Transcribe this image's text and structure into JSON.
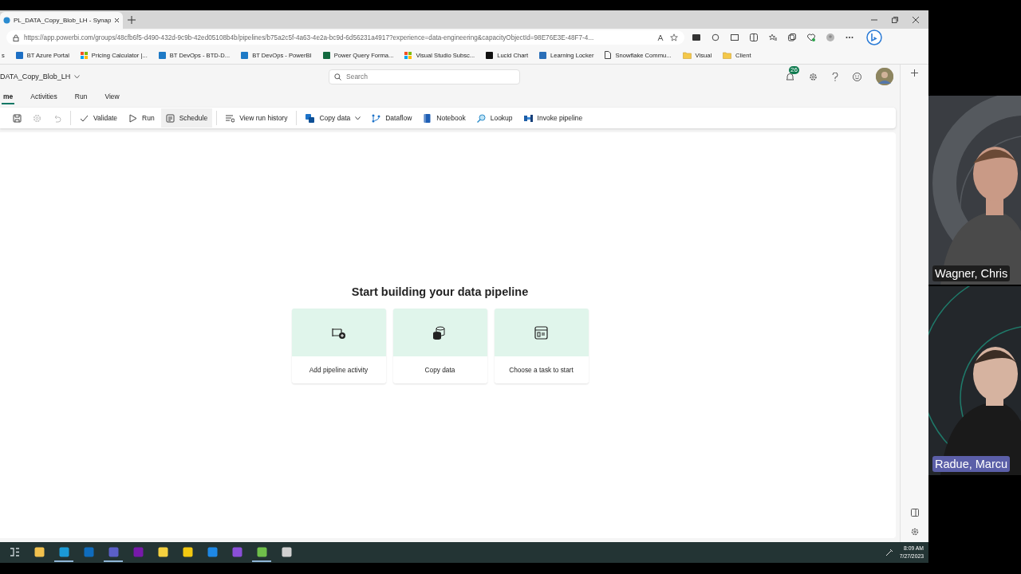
{
  "browser": {
    "tab": {
      "title": "PL_DATA_Copy_Blob_LH - Synap",
      "selected": true
    },
    "address": {
      "url": "https://app.powerbi.com/groups/48cfb6f5-d490-432d-9c9b-42ed05108b4b/pipelines/b75a2c5f-4a63-4e2a-bc9d-6d56231a4917?experience=data-engineering&capacityObjectId=98E76E3E-48F7-4..."
    },
    "bookmarks": [
      {
        "label": "s"
      },
      {
        "label": "BT Azure Portal"
      },
      {
        "label": "Pricing Calculator |..."
      },
      {
        "label": "BT DevOps - BTD-D..."
      },
      {
        "label": "BT DevOps - PowerBI"
      },
      {
        "label": "Power Query Forma..."
      },
      {
        "label": "Visual Studio Subsc..."
      },
      {
        "label": "Lucid Chart"
      },
      {
        "label": "Learning Locker"
      },
      {
        "label": "Snowflake Commu..."
      },
      {
        "label": "Visual"
      },
      {
        "label": "Client"
      }
    ]
  },
  "app": {
    "title": "DATA_Copy_Blob_LH",
    "search": {
      "placeholder": "Search"
    },
    "notifications": "26",
    "ribbon_tabs": [
      {
        "label": "me",
        "selected": true
      },
      {
        "label": "Activities",
        "selected": false
      },
      {
        "label": "Run",
        "selected": false
      },
      {
        "label": "View",
        "selected": false
      }
    ],
    "toolbar": [
      {
        "disabled": false,
        "hovered": false
      },
      {
        "disabled": true,
        "hovered": false
      },
      {
        "disabled": true,
        "hovered": false
      },
      {
        "label": "Validate",
        "disabled": false,
        "hovered": false
      },
      {
        "label": "Run",
        "disabled": false,
        "hovered": false
      },
      {
        "label": "Schedule",
        "disabled": false,
        "hovered": true
      },
      {
        "label": "View run history",
        "disabled": false,
        "hovered": false
      },
      {
        "label": "Copy data",
        "disabled": false,
        "hovered": false,
        "dropdown": true
      },
      {
        "label": "Dataflow",
        "disabled": false,
        "hovered": false
      },
      {
        "label": "Notebook",
        "disabled": false,
        "hovered": false
      },
      {
        "label": "Lookup",
        "disabled": false,
        "hovered": false
      },
      {
        "label": "Invoke pipeline",
        "disabled": false,
        "hovered": false
      }
    ],
    "canvas": {
      "heading": "Start building your data pipeline",
      "cards": [
        {
          "label": "Add pipeline activity"
        },
        {
          "label": "Copy data"
        },
        {
          "label": "Choose a task to start"
        }
      ]
    }
  },
  "taskbar": {
    "apps": [
      {
        "running": false
      },
      {
        "running": false
      },
      {
        "running": true
      },
      {
        "running": false
      },
      {
        "running": true
      },
      {
        "running": false
      },
      {
        "running": false
      },
      {
        "running": false
      },
      {
        "running": false
      },
      {
        "running": false
      },
      {
        "running": true
      },
      {
        "running": false
      }
    ],
    "time": "8:09 AM",
    "date": "7/27/2023"
  },
  "participants": [
    {
      "name": "Wagner, Chris",
      "color": "#1e1e1e"
    },
    {
      "name": "Radue, Marcu",
      "color": "#5b5fa8"
    }
  ]
}
